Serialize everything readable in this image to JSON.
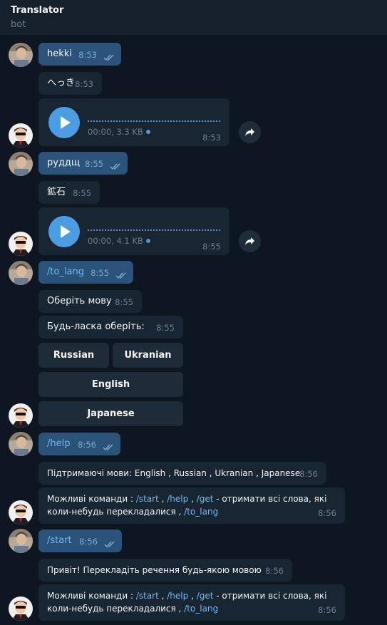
{
  "header": {
    "title": "Translator",
    "subtitle": "bot"
  },
  "messages": [
    {
      "text": "hekki",
      "time": "8:53"
    },
    {
      "text": "へっき",
      "time": "8:53"
    },
    {
      "voice": "00:00, 3.3 KB",
      "time": "8:53"
    },
    {
      "text": "руддщ",
      "time": "8:55"
    },
    {
      "text": "鉱石",
      "time": "8:55"
    },
    {
      "voice": "00:00, 4.1 KB",
      "time": "8:55"
    },
    {
      "text": "/to_lang",
      "time": "8:55"
    },
    {
      "text": "Оберіть мову",
      "time": "8:55"
    },
    {
      "text": "Будь-ласка оберіть:",
      "time": "8:55"
    },
    {
      "text": "/help",
      "time": "8:56"
    },
    {
      "text": "Підтримаючі мови: English , Russian , Ukranian , Japanese",
      "time": "8:56"
    },
    {
      "p1": "Можливі команди : ",
      "c1": "/start",
      "s1": " , ",
      "c2": "/help",
      "s2": " , ",
      "c3": "/get",
      "p2": " - отримати всі слова, які",
      "p3": "коли-небудь перекладалися  , ",
      "c4": "/to_lang",
      "time": "8:56"
    },
    {
      "text": "/start",
      "time": "8:56"
    },
    {
      "text": "Привіт! Перекладіть речення будь-якою мовою",
      "time": "8:56"
    },
    {
      "p1": "Можливі команди : ",
      "c1": "/start",
      "s1": " , ",
      "c2": "/help",
      "s2": " , ",
      "c3": "/get",
      "p2": " - отримати всі слова, які",
      "p3": "коли-небудь перекладалися  , ",
      "c4": "/to_lang",
      "time": "8:56"
    }
  ],
  "keyboard": [
    "Russian",
    "Ukranian",
    "English",
    "Japanese"
  ],
  "icons": {
    "play": "play-icon",
    "share": "share-arrow-icon",
    "ticks": "double-check-icon"
  },
  "colors": {
    "background": "#0e1621",
    "header": "#17212b",
    "outgoing": "#2b5278",
    "incoming": "#182533",
    "link": "#71baf2",
    "accent": "#4c9ce2"
  }
}
